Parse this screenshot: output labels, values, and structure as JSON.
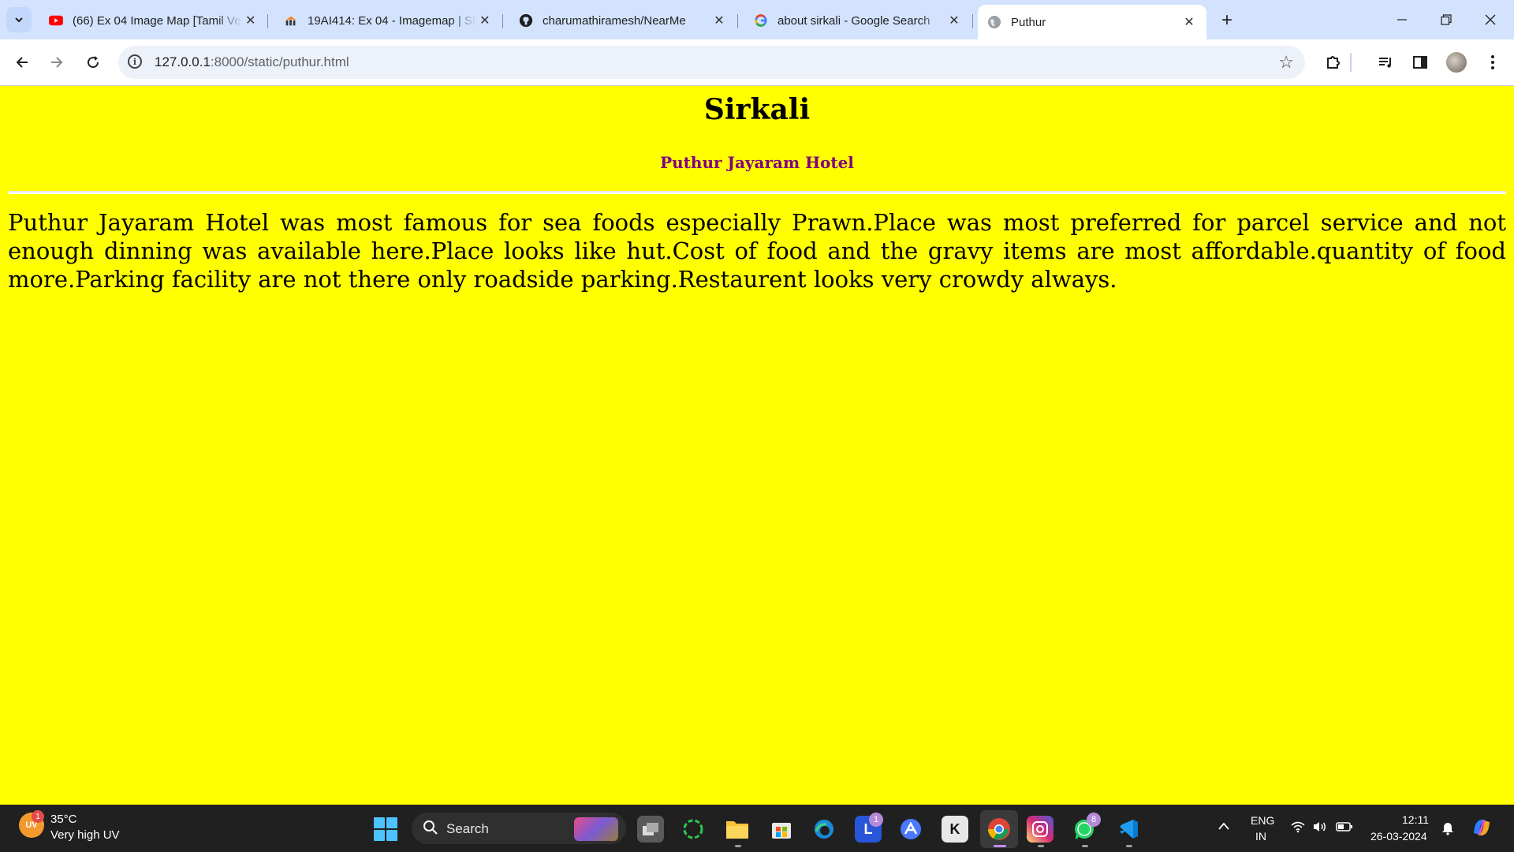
{
  "browser": {
    "tabs": [
      {
        "title": "(66) Ex 04 Image Map [Tamil Version]",
        "favicon": "youtube-icon",
        "active": false
      },
      {
        "title": "19AI414: Ex 04 - Imagemap | SEC",
        "favicon": "moodle-icon",
        "active": false
      },
      {
        "title": "charumathiramesh/NearMe",
        "favicon": "github-icon",
        "active": false
      },
      {
        "title": "about sirkali - Google Search",
        "favicon": "google-icon",
        "active": false
      },
      {
        "title": "Puthur",
        "favicon": "globe-icon",
        "active": true
      }
    ],
    "url_host": "127.0.0.1",
    "url_rest": ":8000/static/puthur.html"
  },
  "page": {
    "heading": "Sirkali",
    "subheading": "Puthur Jayaram Hotel",
    "paragraph": "Puthur Jayaram Hotel was most famous for sea foods especially Prawn.Place was most preferred for parcel service and not enough dinning was available here.Place looks like hut.Cost of food and the gravy items are most affordable.quantity of food more.Parking facility are not there only roadside parking.Restaurent looks very crowdy always.",
    "background_color": "#ffff00",
    "subheading_color": "#800080"
  },
  "taskbar": {
    "weather_temp": "35°C",
    "weather_desc": "Very high UV",
    "weather_icon_label": "UV",
    "weather_badge": "1",
    "search_label": "Search",
    "lang_top": "ENG",
    "lang_bottom": "IN",
    "time": "12:11",
    "date": "26-03-2024",
    "badges": {
      "lens": "1",
      "whatsapp": "8"
    }
  }
}
